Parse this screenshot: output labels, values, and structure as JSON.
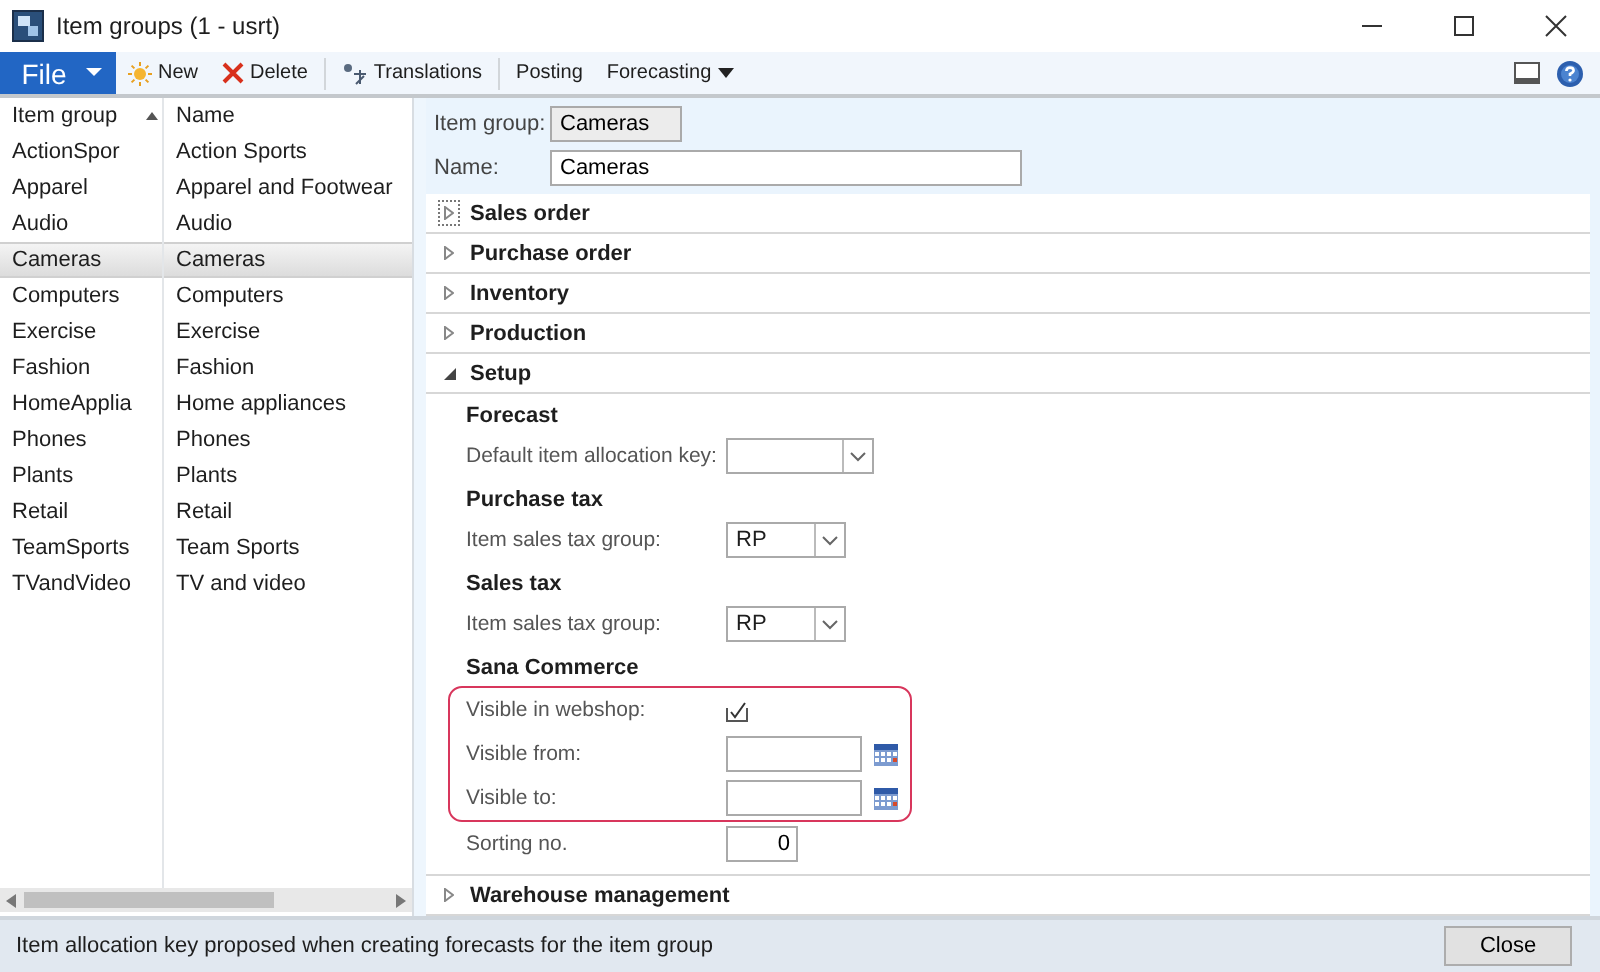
{
  "window": {
    "title": "Item groups (1 - usrt)"
  },
  "toolbar": {
    "file_menu": "File",
    "buttons": [
      {
        "label": "New",
        "kind": "new"
      },
      {
        "label": "Delete",
        "kind": "delete"
      },
      {
        "label": "Translations",
        "kind": "translate"
      },
      {
        "label": "Posting"
      },
      {
        "label": "Forecasting",
        "dropdown": true
      }
    ]
  },
  "list": {
    "columns": [
      "Item group",
      "Name"
    ],
    "rows": [
      {
        "cells": [
          "ActionSpor",
          "Action Sports"
        ],
        "selected": false
      },
      {
        "cells": [
          "Apparel",
          "Apparel and Footwear"
        ],
        "selected": false
      },
      {
        "cells": [
          "Audio",
          "Audio"
        ],
        "selected": false
      },
      {
        "cells": [
          "Cameras",
          "Cameras"
        ],
        "selected": true
      },
      {
        "cells": [
          "Computers",
          "Computers"
        ],
        "selected": false
      },
      {
        "cells": [
          "Exercise",
          "Exercise"
        ],
        "selected": false
      },
      {
        "cells": [
          "Fashion",
          "Fashion"
        ],
        "selected": false
      },
      {
        "cells": [
          "HomeApplia",
          "Home appliances"
        ],
        "selected": false
      },
      {
        "cells": [
          "Phones",
          "Phones"
        ],
        "selected": false
      },
      {
        "cells": [
          "Plants",
          "Plants"
        ],
        "selected": false
      },
      {
        "cells": [
          "Retail",
          "Retail"
        ],
        "selected": false
      },
      {
        "cells": [
          "TeamSports",
          "Team Sports"
        ],
        "selected": false
      },
      {
        "cells": [
          "TVandVideo",
          "TV and video"
        ],
        "selected": false
      }
    ]
  },
  "header_fields": [
    {
      "label": "Item group:",
      "value": "Cameras",
      "readonly": true
    },
    {
      "label": "Name:",
      "value": "Cameras",
      "readonly": false
    }
  ],
  "fast_tabs": [
    {
      "title": "Sales order",
      "expanded": false,
      "focused": true
    },
    {
      "title": "Purchase order",
      "expanded": false,
      "focused": false
    },
    {
      "title": "Inventory",
      "expanded": false,
      "focused": false
    },
    {
      "title": "Production",
      "expanded": false,
      "focused": false
    },
    {
      "title": "Setup",
      "expanded": true,
      "focused": false,
      "groups": [
        {
          "title": "Forecast",
          "fields": [
            {
              "kind": "combo",
              "label": "Default item allocation key:",
              "highlighted": false
            }
          ]
        },
        {
          "title": "Purchase tax",
          "fields": [
            {
              "kind": "combo",
              "label": "Item sales tax group:",
              "value": "RP",
              "highlighted": false
            }
          ]
        },
        {
          "title": "Sales tax",
          "fields": [
            {
              "kind": "combo",
              "label": "Item sales tax group:",
              "value": "RP",
              "highlighted": false
            }
          ]
        },
        {
          "title": "Sana Commerce",
          "fields": [
            {
              "kind": "checkbox",
              "label": "Visible in webshop:",
              "checked": true,
              "highlighted": true
            },
            {
              "kind": "date",
              "label": "Visible from:",
              "highlighted": true
            },
            {
              "kind": "date",
              "label": "Visible to:",
              "highlighted": true
            },
            {
              "kind": "number",
              "label": "Sorting no.",
              "value": "0",
              "highlighted": false
            }
          ]
        }
      ]
    },
    {
      "title": "Warehouse management",
      "expanded": false,
      "focused": false
    }
  ],
  "status_bar": {
    "text": "Item allocation key proposed when creating forecasts for the item group",
    "close_button": "Close"
  }
}
